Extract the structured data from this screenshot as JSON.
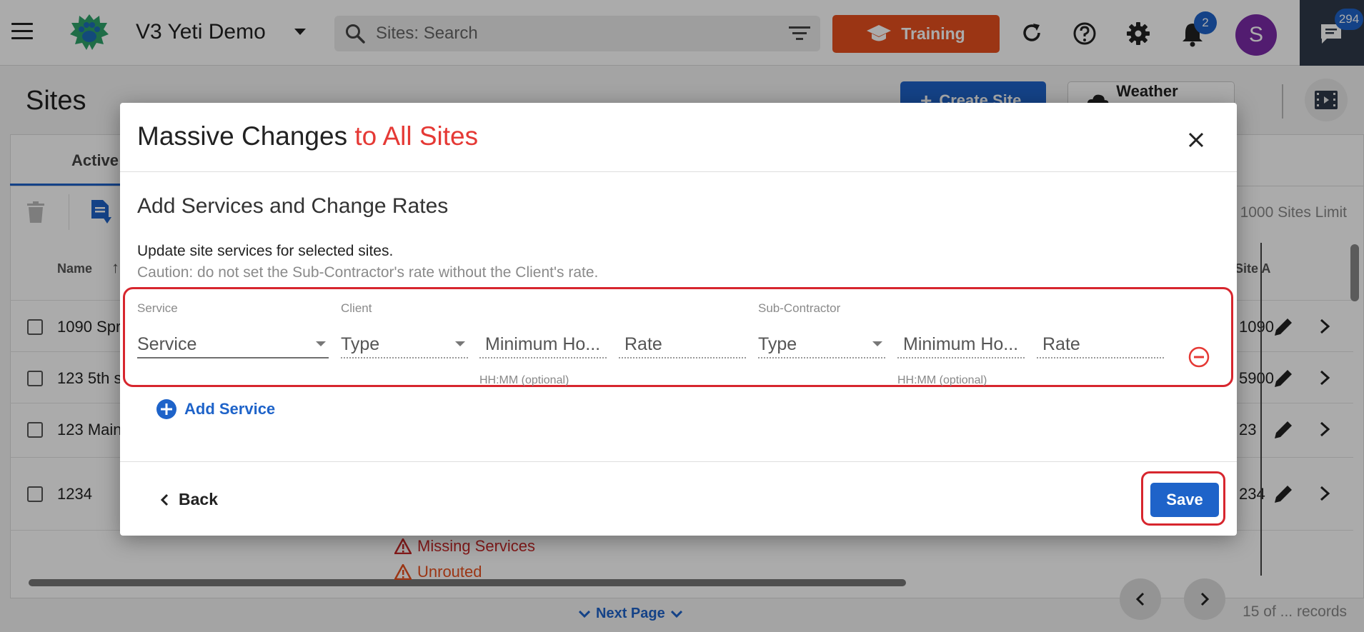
{
  "topbar": {
    "app_title": "V3 Yeti Demo",
    "search_placeholder": "Sites: Search",
    "training_label": "Training",
    "notifications_count": "2",
    "avatar_initial": "S",
    "chat_count": "294"
  },
  "page": {
    "title": "Sites",
    "create_label": "Create Site",
    "weather_label": "Weather Bundles",
    "active_tab": "Active",
    "limit_text": "1000 Sites Limit",
    "name_header": "Name",
    "site_header": "Site A",
    "rows": [
      {
        "name": "1090 Spr",
        "site": "1090"
      },
      {
        "name": "123 5th s",
        "site": "5900"
      },
      {
        "name": "123 Main",
        "site": "23"
      },
      {
        "name": "1234",
        "site": "234"
      }
    ],
    "warn_missing": "Missing Services",
    "warn_unrouted": "Unrouted",
    "next_page": "Next Page",
    "records": "15 of ... records"
  },
  "modal": {
    "title_main": "Massive Changes",
    "title_accent": "to All Sites",
    "section_title": "Add Services and Change Rates",
    "description": "Update site services for selected sites.",
    "caution": "Caution: do not set the Sub-Contractor's rate without the Client's rate.",
    "labels": {
      "service": "Service",
      "client": "Client",
      "subcontractor": "Sub-Contractor"
    },
    "fields": {
      "service": "Service",
      "client_type": "Type",
      "client_min_hours": "Minimum Ho...",
      "client_rate": "Rate",
      "sub_type": "Type",
      "sub_min_hours": "Minimum Ho...",
      "sub_rate": "Rate"
    },
    "hint": "HH:MM (optional)",
    "add_service": "Add Service",
    "back": "Back",
    "save": "Save"
  },
  "colors": {
    "primary": "#1e63c9",
    "training": "#e8501e",
    "accent_red": "#e53935",
    "highlight": "#d7262e",
    "avatar": "#7b2ba8"
  }
}
